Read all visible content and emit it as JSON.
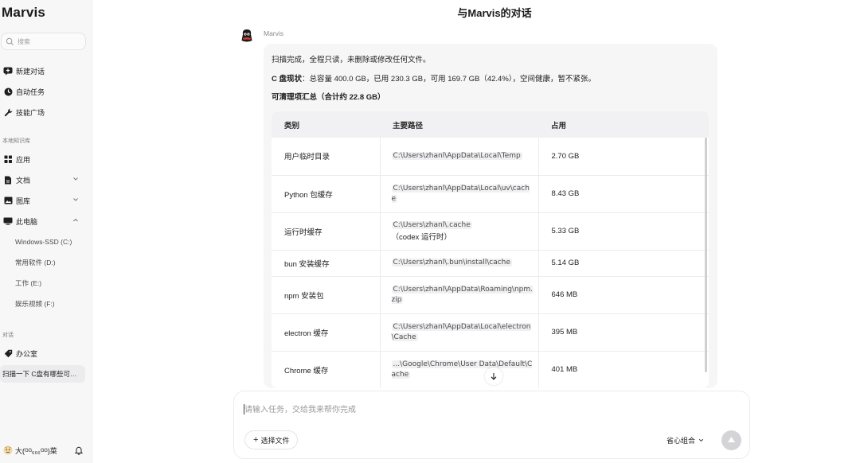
{
  "app": {
    "brand": "Marvis"
  },
  "sidebar": {
    "search_placeholder": "搜索",
    "primary": [
      {
        "label": "新建对话",
        "icon": "new-chat-icon"
      },
      {
        "label": "自动任务",
        "icon": "clock-icon"
      },
      {
        "label": "技能广场",
        "icon": "wrench-icon"
      }
    ],
    "kb_section": "本地知识库",
    "kb_items": [
      {
        "label": "应用",
        "icon": "grid-icon"
      },
      {
        "label": "文档",
        "icon": "document-icon",
        "expanded": false
      },
      {
        "label": "图库",
        "icon": "image-icon",
        "expanded": false
      },
      {
        "label": "此电脑",
        "icon": "monitor-icon",
        "expanded": true
      }
    ],
    "drives": [
      "Windows-SSD (C:)",
      "常用软件 (D:)",
      "工作 (E:)",
      "娱乐视频 (F:)"
    ],
    "conv_section": "对话",
    "conv_group": "办公室",
    "active_conversation": "扫描一下 C盘有哪些可…",
    "user_name": "大(ᴳᴳ₆₆₆ᴳᴳ)菜"
  },
  "chat": {
    "title": "与Marvis的对话",
    "bot_name": "Marvis",
    "line1": "扫描完成，全程只读，未删除或修改任何文件。",
    "line2_label": "C 盘现状",
    "line2_text": "：总容量 400.0 GB，已用 230.3 GB，可用 169.7 GB（42.4%），空间健康，暂不紧张。",
    "summary": "可清理项汇总（合计约 22.8 GB）",
    "table": {
      "headers": [
        "类别",
        "主要路径",
        "占用"
      ],
      "rows": [
        {
          "category": "用户临时目录",
          "path": "C:\\Users\\zhanl\\AppData\\Local\\Temp",
          "note": "",
          "size": "2.70 GB"
        },
        {
          "category": "Python 包缓存",
          "path": "C:\\Users\\zhanl\\AppData\\Local\\uv\\cache",
          "note": "",
          "size": "8.43 GB"
        },
        {
          "category": "运行时缓存",
          "path": "C:\\Users\\zhanl\\.cache",
          "note": "（codex 运行时）",
          "size": "5.33 GB"
        },
        {
          "category": "bun 安装缓存",
          "path": "C:\\Users\\zhanl\\.bun\\install\\cache",
          "note": "",
          "size": "5.14 GB"
        },
        {
          "category": "npm 安装包",
          "path": "C:\\Users\\zhanl\\AppData\\Roaming\\npm.zip",
          "note": "",
          "size": "646 MB"
        },
        {
          "category": "electron 缓存",
          "path": "C:\\Users\\zhanl\\AppData\\Local\\electron\\Cache",
          "note": "",
          "size": "395 MB"
        },
        {
          "category": "Chrome 缓存",
          "path": "...\\Google\\Chrome\\User Data\\Default\\Cache",
          "note": "",
          "size": "401 MB"
        }
      ]
    }
  },
  "composer": {
    "placeholder": "请输入任务，交给我来帮你完成",
    "pick_file": "选择文件",
    "mode": "省心组合"
  }
}
